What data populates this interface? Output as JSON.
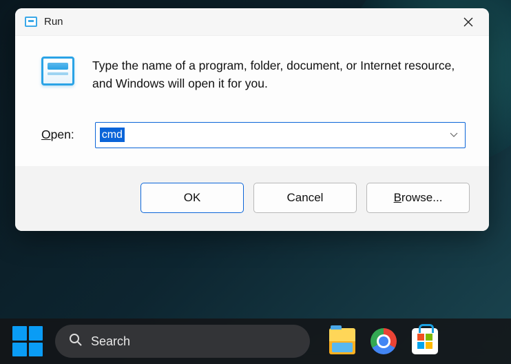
{
  "dialog": {
    "title": "Run",
    "description": "Type the name of a program, folder, document, or Internet resource, and Windows will open it for you.",
    "open_label_pre": "O",
    "open_label_rest": "pen:",
    "input_value": "cmd",
    "buttons": {
      "ok": "OK",
      "cancel": "Cancel",
      "browse_pre": "B",
      "browse_rest": "rowse..."
    }
  },
  "taskbar": {
    "search_placeholder": "Search"
  }
}
